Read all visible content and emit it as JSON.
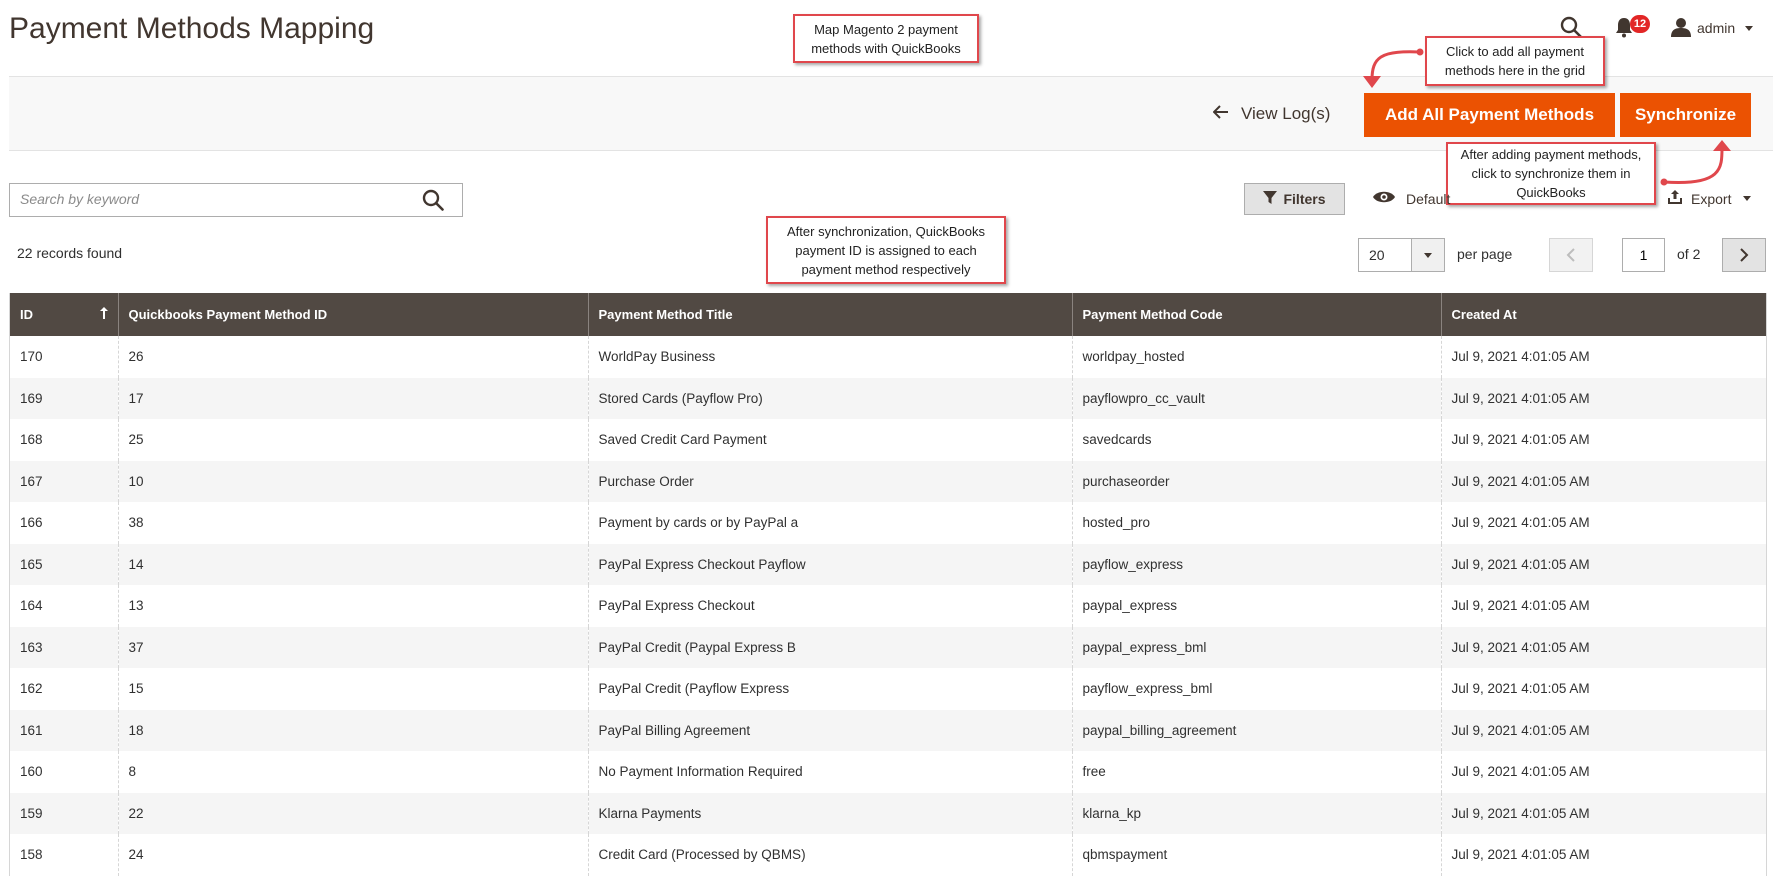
{
  "header": {
    "title": "Payment Methods Mapping",
    "notifications_count": "12",
    "user_name": "admin"
  },
  "actions": {
    "view_log": "View Log(s)",
    "add_all": "Add All Payment Methods",
    "synchronize": "Synchronize"
  },
  "callouts": {
    "top": "Map Magento 2 payment methods with QuickBooks",
    "add_all": "Click to add all payment methods here in the grid",
    "sync": "After adding payment methods, click to synchronize them in QuickBooks",
    "qb_id": "After synchronization, QuickBooks payment ID is assigned to each payment method respectively"
  },
  "toolbar": {
    "search_placeholder": "Search by keyword",
    "filters": "Filters",
    "view_label": "Default",
    "export": "Export"
  },
  "grid_meta": {
    "records_found": "22 records found",
    "per_page_value": "20",
    "per_page_label": "per page",
    "current_page": "1",
    "total_pages": "of 2"
  },
  "columns": [
    "ID",
    "Quickbooks Payment Method ID",
    "Payment Method Title",
    "Payment Method Code",
    "Created At"
  ],
  "rows": [
    [
      "170",
      "26",
      "WorldPay Business",
      "worldpay_hosted",
      "Jul 9, 2021 4:01:05 AM"
    ],
    [
      "169",
      "17",
      "Stored Cards (Payflow Pro)",
      "payflowpro_cc_vault",
      "Jul 9, 2021 4:01:05 AM"
    ],
    [
      "168",
      "25",
      "Saved Credit Card Payment",
      "savedcards",
      "Jul 9, 2021 4:01:05 AM"
    ],
    [
      "167",
      "10",
      "Purchase Order",
      "purchaseorder",
      "Jul 9, 2021 4:01:05 AM"
    ],
    [
      "166",
      "38",
      "Payment by cards or by PayPal a",
      "hosted_pro",
      "Jul 9, 2021 4:01:05 AM"
    ],
    [
      "165",
      "14",
      "PayPal Express Checkout Payflow",
      "payflow_express",
      "Jul 9, 2021 4:01:05 AM"
    ],
    [
      "164",
      "13",
      "PayPal Express Checkout",
      "paypal_express",
      "Jul 9, 2021 4:01:05 AM"
    ],
    [
      "163",
      "37",
      "PayPal Credit (Paypal Express B",
      "paypal_express_bml",
      "Jul 9, 2021 4:01:05 AM"
    ],
    [
      "162",
      "15",
      "PayPal Credit (Payflow Express",
      "payflow_express_bml",
      "Jul 9, 2021 4:01:05 AM"
    ],
    [
      "161",
      "18",
      "PayPal Billing Agreement",
      "paypal_billing_agreement",
      "Jul 9, 2021 4:01:05 AM"
    ],
    [
      "160",
      "8",
      "No Payment Information Required",
      "free",
      "Jul 9, 2021 4:01:05 AM"
    ],
    [
      "159",
      "22",
      "Klarna Payments",
      "klarna_kp",
      "Jul 9, 2021 4:01:05 AM"
    ],
    [
      "158",
      "24",
      "Credit Card (Processed by QBMS)",
      "qbmspayment",
      "Jul 9, 2021 4:01:05 AM"
    ]
  ],
  "colors": {
    "accent": "#eb5202",
    "grid_header": "#514943",
    "callout_border": "#e0474c",
    "badge": "#e22626"
  }
}
